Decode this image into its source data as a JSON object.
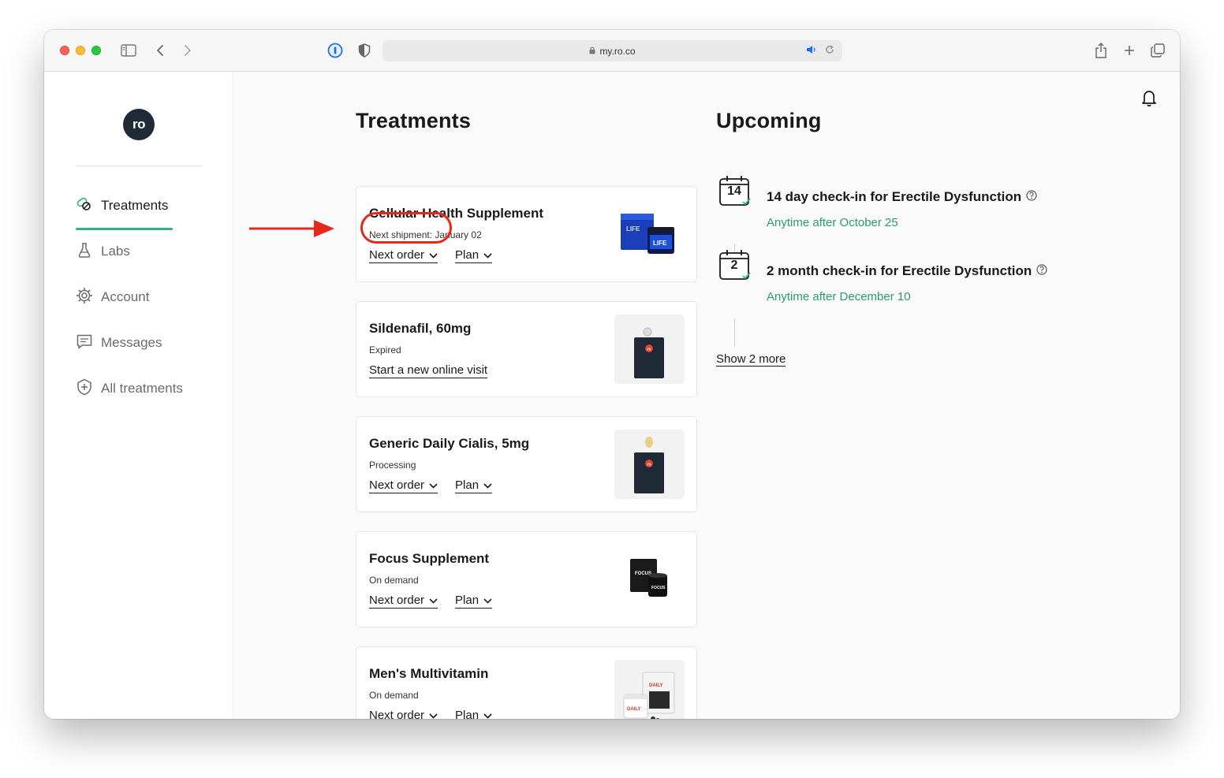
{
  "browser": {
    "url": "my.ro.co"
  },
  "sidebar": {
    "logo": "ro",
    "items": [
      {
        "label": "Treatments",
        "icon": "pill-icon"
      },
      {
        "label": "Labs",
        "icon": "flask-icon"
      },
      {
        "label": "Account",
        "icon": "gear-icon"
      },
      {
        "label": "Messages",
        "icon": "message-icon"
      },
      {
        "label": "All treatments",
        "icon": "shield-plus-icon"
      }
    ]
  },
  "treatments": {
    "heading": "Treatments",
    "cards": [
      {
        "name": "Cellular Health Supplement",
        "status": "Next shipment: January 02",
        "links": [
          "Next order",
          "Plan"
        ]
      },
      {
        "name": "Sildenafil, 60mg",
        "status": "Expired",
        "links": [
          "Start a new online visit"
        ]
      },
      {
        "name": "Generic Daily Cialis, 5mg",
        "status": "Processing",
        "links": [
          "Next order",
          "Plan"
        ]
      },
      {
        "name": "Focus Supplement",
        "status": "On demand",
        "links": [
          "Next order",
          "Plan"
        ]
      },
      {
        "name": "Men's Multivitamin",
        "status": "On demand",
        "links": [
          "Next order",
          "Plan"
        ]
      }
    ]
  },
  "upcoming": {
    "heading": "Upcoming",
    "items": [
      {
        "day": "14",
        "title": "14 day check-in for Erectile Dysfunction",
        "subtitle": "Anytime after October 25"
      },
      {
        "day": "2",
        "title": "2 month check-in for Erectile Dysfunction",
        "subtitle": "Anytime after December 10"
      }
    ],
    "show_more": "Show 2 more"
  },
  "product_labels": {
    "life": "LIFE",
    "focus": "FOCUS",
    "daily": "DAILY",
    "ro": "ro"
  },
  "colors": {
    "accent_green": "#2bb586",
    "highlight_red": "#e8271b",
    "logo_bg": "#1e2a36"
  }
}
